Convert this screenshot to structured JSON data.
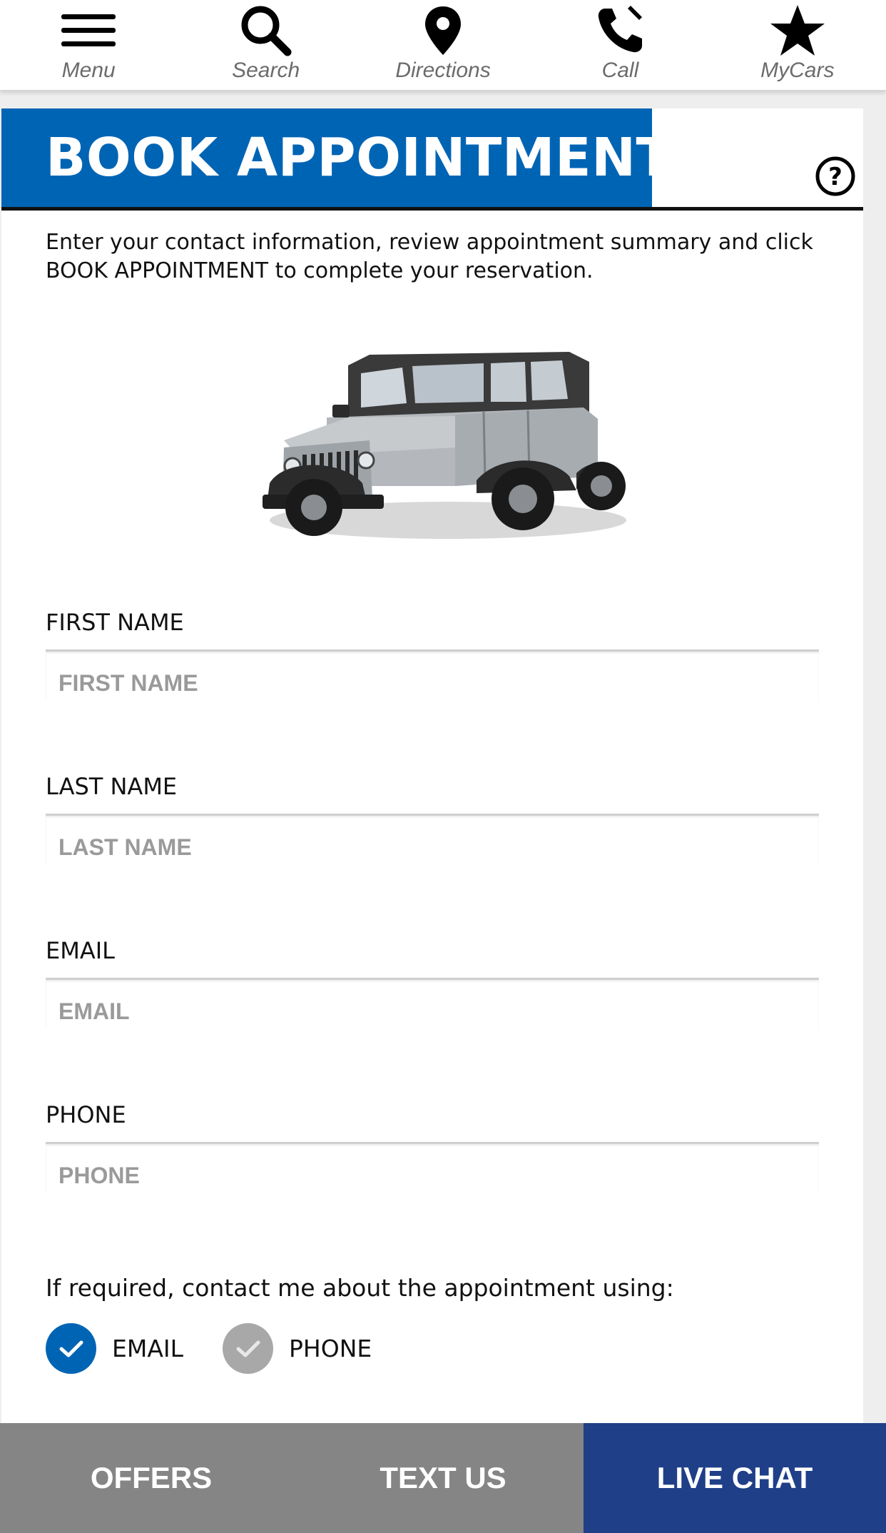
{
  "nav": {
    "items": [
      {
        "label": "Menu",
        "icon": "hamburger-icon"
      },
      {
        "label": "Search",
        "icon": "search-icon"
      },
      {
        "label": "Directions",
        "icon": "map-pin-icon"
      },
      {
        "label": "Call",
        "icon": "phone-icon"
      },
      {
        "label": "MyCars",
        "icon": "star-icon"
      }
    ]
  },
  "header": {
    "title": "BOOK APPOINTMENT",
    "help_icon": "help-circle-icon"
  },
  "intro": "Enter your contact information, review appointment summary and click BOOK APPOINTMENT to complete your reservation.",
  "form": {
    "first_name": {
      "label": "FIRST NAME",
      "placeholder": "FIRST NAME",
      "value": ""
    },
    "last_name": {
      "label": "LAST NAME",
      "placeholder": "LAST NAME",
      "value": ""
    },
    "email": {
      "label": "EMAIL",
      "placeholder": "EMAIL",
      "value": ""
    },
    "phone": {
      "label": "PHONE",
      "placeholder": "PHONE",
      "value": ""
    }
  },
  "contact_pref": {
    "question": "If required, contact me about the appointment using:",
    "options": [
      {
        "label": "EMAIL",
        "selected": true
      },
      {
        "label": "PHONE",
        "selected": false
      }
    ]
  },
  "bottom_bar": {
    "offers": "OFFERS",
    "text_us": "TEXT US",
    "live_chat": "LIVE CHAT"
  },
  "colors": {
    "brand_blue": "#0064b4",
    "chat_blue": "#1f3f88",
    "bar_gray": "#858585",
    "unselected_gray": "#a8a8a8"
  }
}
